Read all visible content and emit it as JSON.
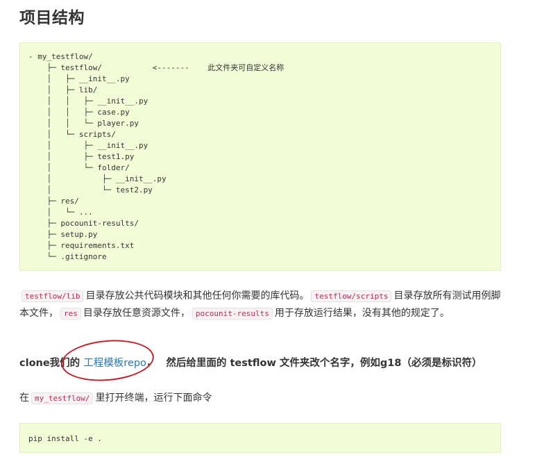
{
  "heading": "项目结构",
  "tree": {
    "lines": [
      "- my_testflow/",
      "    ├─ testflow/           <-------",
      "    │   ├─ __init__.py",
      "    │   ├─ lib/",
      "    │   │   ├─ __init__.py",
      "    │   │   ├─ case.py",
      "    │   │   └─ player.py",
      "    │   └─ scripts/",
      "    │       ├─ __init__.py",
      "    │       ├─ test1.py",
      "    │       └─ folder/",
      "    │           ├─ __init__.py",
      "    │           └─ test2.py",
      "    ├─ res/",
      "    │   └─ ...",
      "    ├─ pocounit-results/",
      "    ├─ setup.py",
      "    ├─ requirements.txt",
      "    └─ .gitignore"
    ],
    "note": "此文件夹可自定义名称"
  },
  "description": {
    "code_lib": "testflow/lib",
    "text_lib": "目录存放公共代码模块和其他任何你需要的库代码。",
    "code_scripts": "testflow/scripts",
    "text_scripts": "目录存放所有测试用例脚本文件，",
    "code_res": "res",
    "text_res": "目录存放任意资源文件，",
    "code_results": "pocounit-results",
    "text_results": "用于存放运行结果，没有其他的规定了。"
  },
  "clone": {
    "prefix": "clone我们的",
    "link": "工程模板repo",
    "suffix": "，",
    "rest": "然后给里面的 testflow 文件夹改个名字，例如g18（必须是标识符）"
  },
  "terminal": {
    "prefix": "在",
    "code": "my_testflow/",
    "suffix": "里打开终端，运行下面命令"
  },
  "command": "pip install -e ."
}
